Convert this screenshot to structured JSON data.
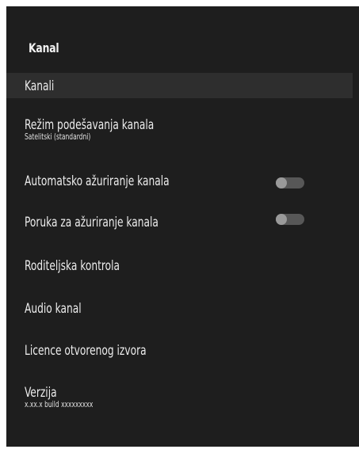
{
  "page": {
    "title": "Kanal"
  },
  "menu": {
    "items": [
      {
        "label": "Kanali"
      },
      {
        "label": "Režim podešavanja kanala",
        "value": "Satelitski (standardni)"
      },
      {
        "label": "Automatsko ažuriranje kanala",
        "toggle_on": false
      },
      {
        "label": "Poruka za ažuriranje kanala",
        "toggle_on": false
      },
      {
        "label": "Roditeljska kontrola"
      },
      {
        "label": "Audio kanal"
      },
      {
        "label": "Licence otvorenog izvora"
      },
      {
        "label": "Verzija",
        "value": "x.xx.x build xxxxxxxxx"
      }
    ]
  }
}
